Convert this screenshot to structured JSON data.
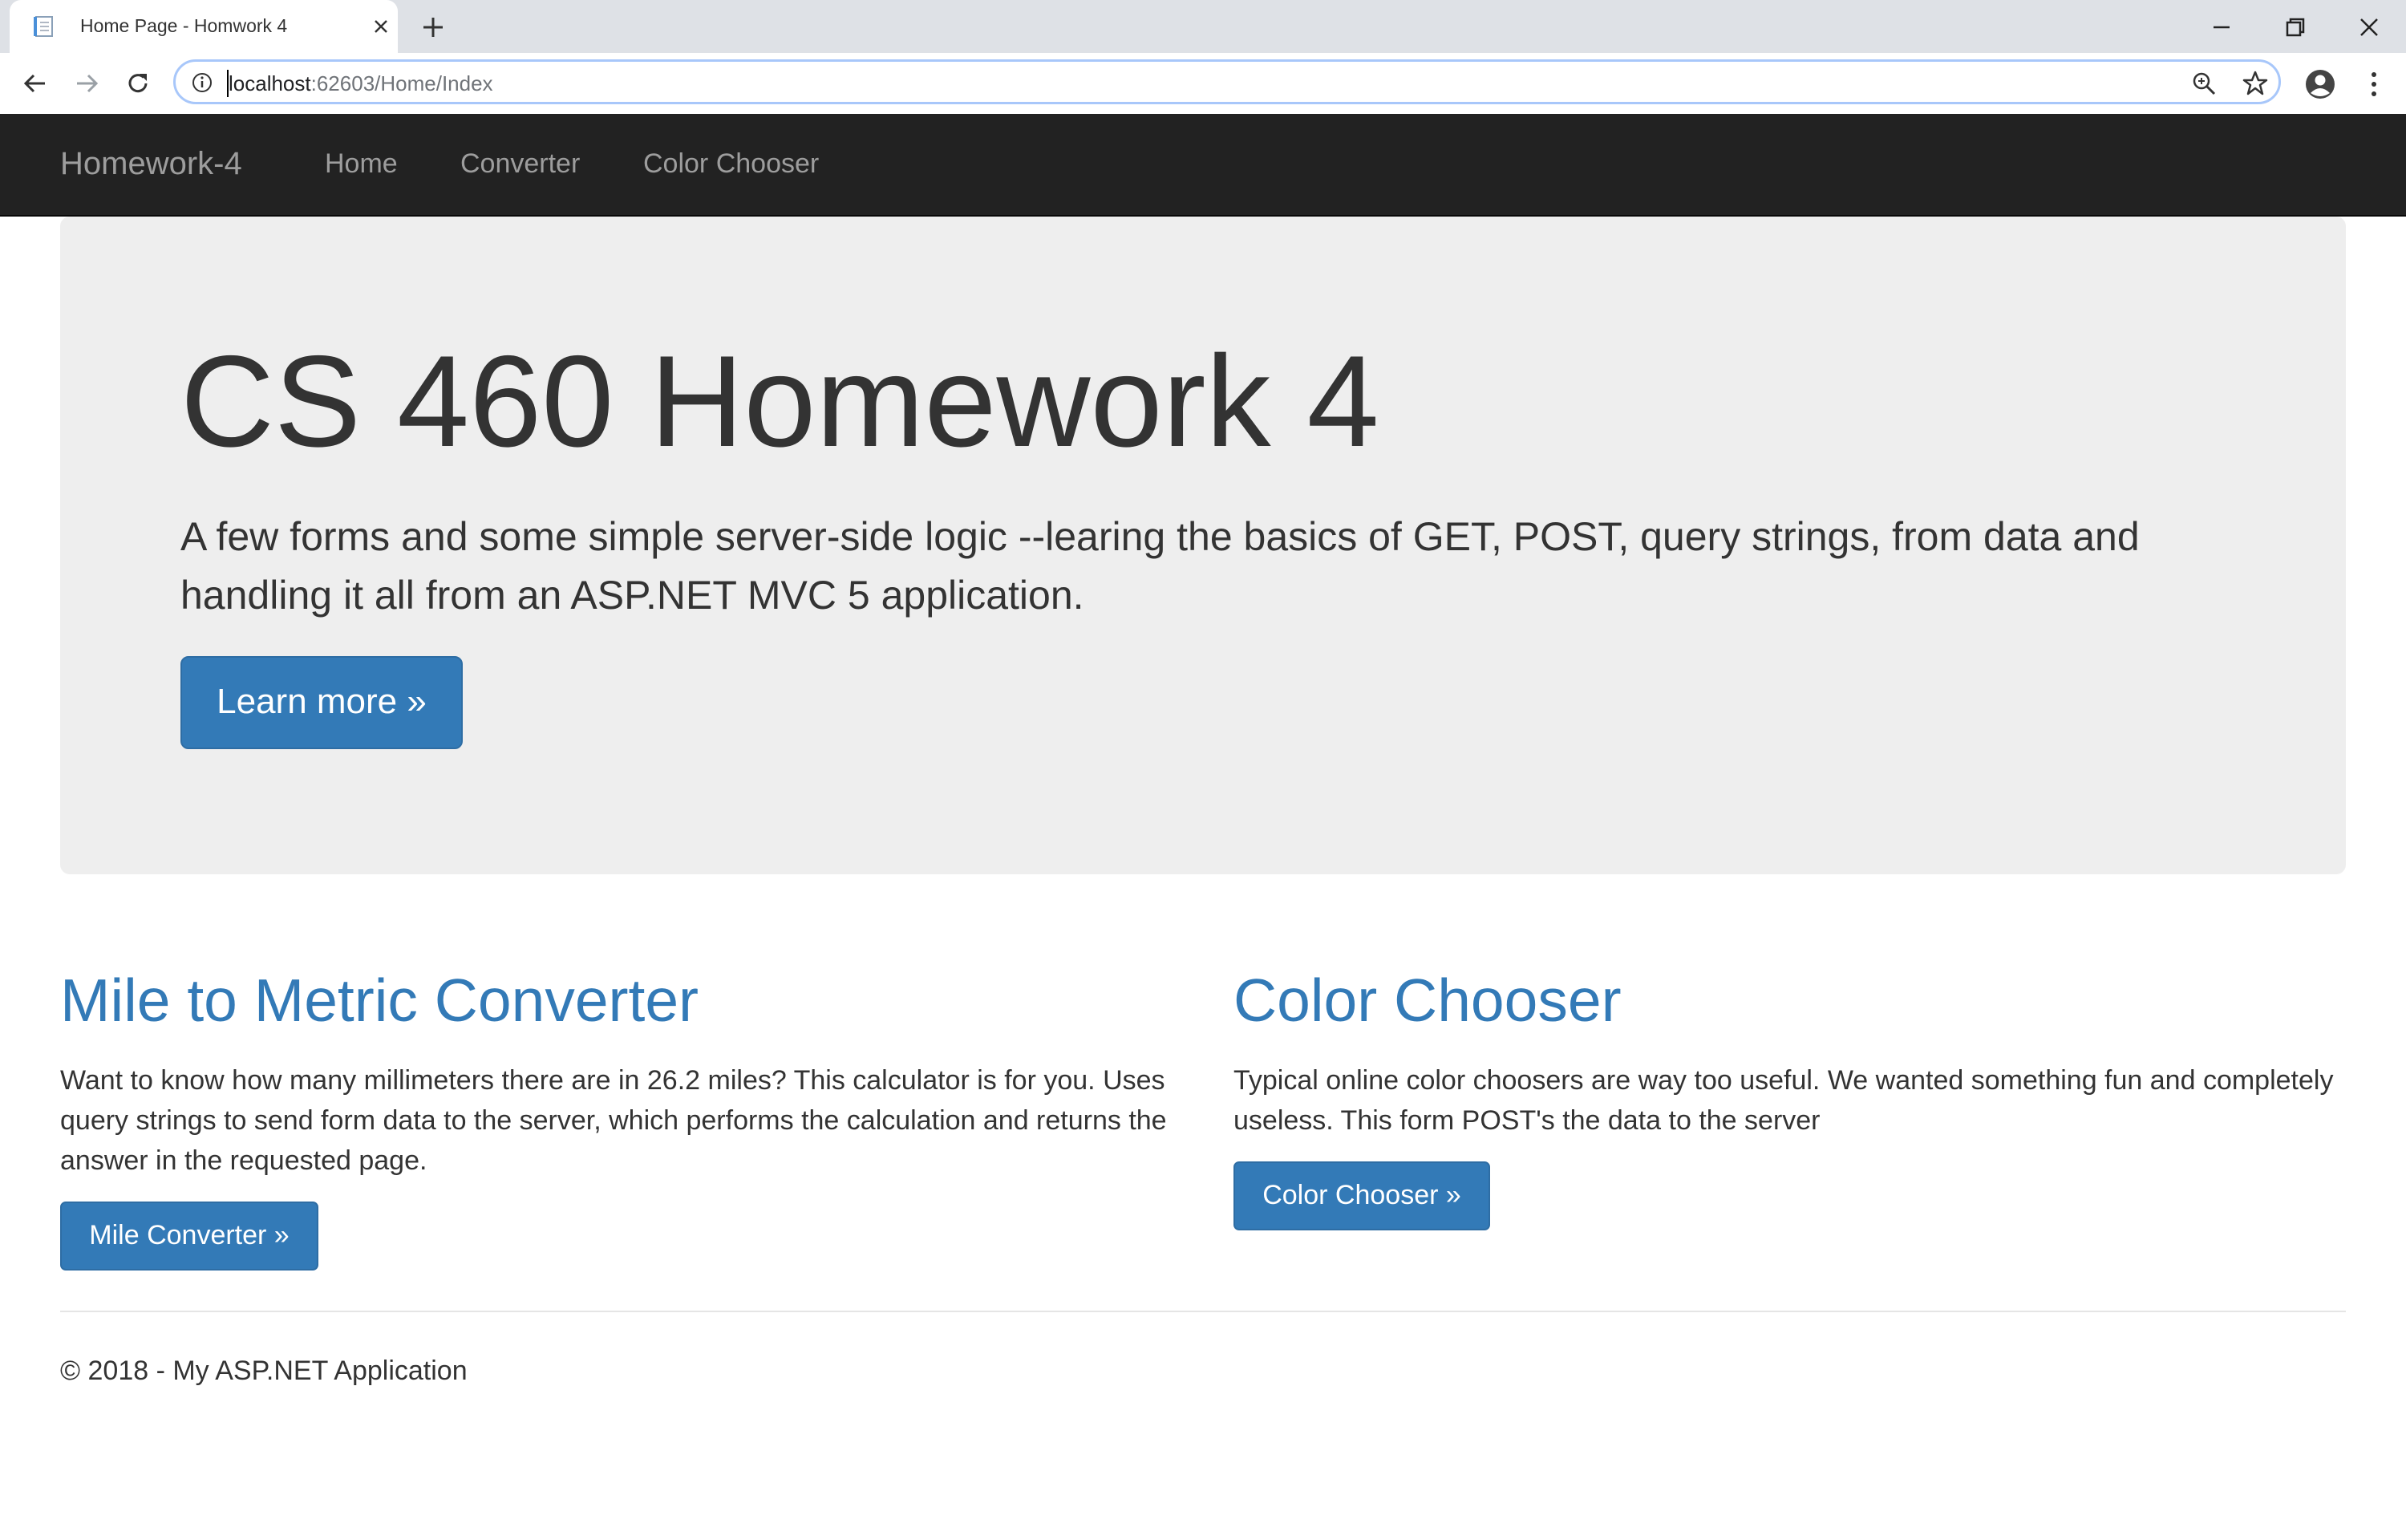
{
  "browser": {
    "tab_title": "Home Page - Homwork 4",
    "url_host": "localhost",
    "url_path": ":62603/Home/Index"
  },
  "navbar": {
    "brand": "Homework-4",
    "links": [
      "Home",
      "Converter",
      "Color Chooser"
    ]
  },
  "jumbotron": {
    "title": "CS 460 Homework 4",
    "lead": "A few forms and some simple server-side logic --learing the basics of GET, POST, query strings, from data and handling it all from an ASP.NET MVC 5 application.",
    "button": "Learn more »"
  },
  "columns": [
    {
      "title": "Mile to Metric Converter",
      "text": "Want to know how many millimeters there are in 26.2 miles? This calculator is for you. Uses query strings to send form data to the server, which performs the calculation and returns the answer in the requested page.",
      "button": "Mile Converter »"
    },
    {
      "title": "Color Chooser",
      "text": "Typical online color choosers are way too useful. We wanted something fun and completely useless. This form POST's the data to the server",
      "button": "Color Chooser »"
    }
  ],
  "footer": "© 2018 - My ASP.NET Application",
  "colors": {
    "navbar_bg": "#222222",
    "jumbotron_bg": "#eeeeee",
    "primary": "#337ab7",
    "link": "#337ab7"
  }
}
